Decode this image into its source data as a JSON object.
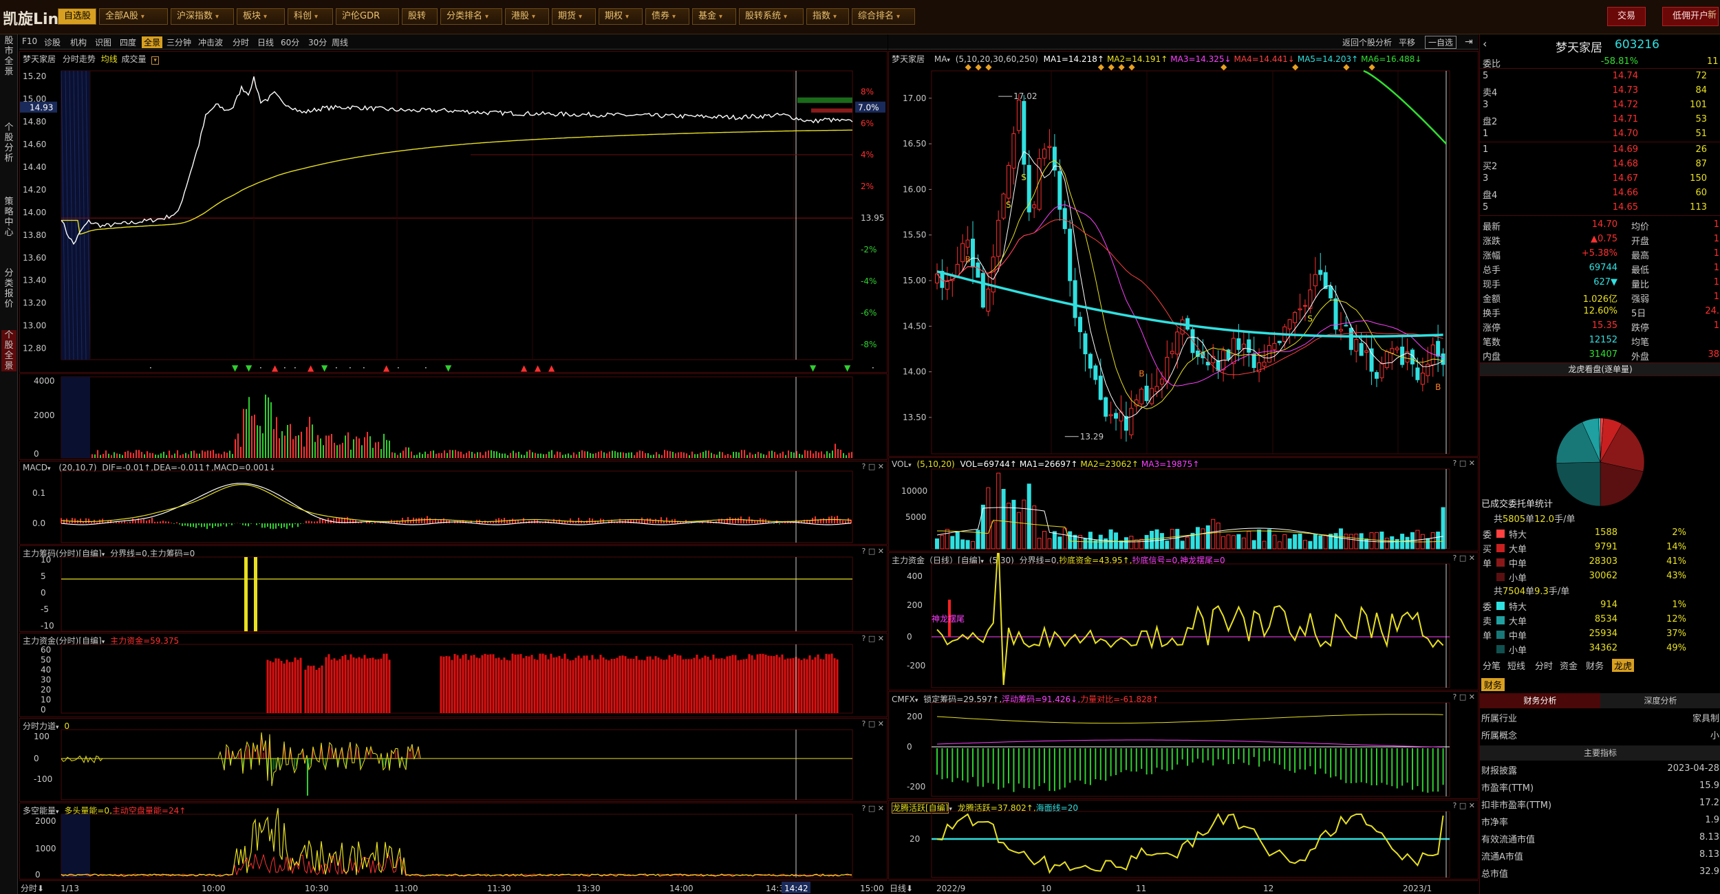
{
  "topbar": {
    "logo": "凯旋Lin",
    "menu": [
      {
        "label": "自选股",
        "active": true
      },
      {
        "label": "全部A股",
        "dd": true
      },
      {
        "label": "沪深指数",
        "dd": true
      },
      {
        "label": "板块",
        "dd": true
      },
      {
        "label": "科创",
        "dd": true
      },
      {
        "label": "沪伦GDR"
      },
      {
        "label": "股转"
      },
      {
        "label": "分类排名",
        "dd": true
      },
      {
        "label": "港股",
        "dd": true
      },
      {
        "label": "期货",
        "dd": true
      },
      {
        "label": "期权",
        "dd": true
      },
      {
        "label": "债券",
        "dd": true
      },
      {
        "label": "基金",
        "dd": true
      },
      {
        "label": "股转系统",
        "dd": true
      },
      {
        "label": "指数",
        "dd": true
      },
      {
        "label": "综合排名",
        "dd": true
      }
    ],
    "right_buttons": [
      "交易",
      "低佣开户",
      "新"
    ]
  },
  "toolbar_left": [
    "F10",
    "诊股",
    "机构",
    "识图",
    "四度",
    "全景",
    "三分钟",
    "冲击波",
    "分时",
    "日线",
    "60分",
    "30分",
    "周线"
  ],
  "toolbar_right": [
    "返回个股分析",
    "平移",
    "一自选"
  ],
  "side_tabs": [
    "股市全景",
    "个股分析",
    "策略中心",
    "分类报价",
    "个股全景"
  ],
  "intraday": {
    "title": "梦天家居",
    "subtitle": "分时走势",
    "legend_avg": "均线",
    "legend_vol": "成交量",
    "price_ticks": [
      "15.20",
      "15.00",
      "14.80",
      "14.60",
      "14.40",
      "14.20",
      "14.00",
      "13.80",
      "13.60",
      "13.40",
      "13.20",
      "13.00",
      "12.80"
    ],
    "pct_ticks": [
      "8%",
      "6%",
      "4%",
      "2%",
      "-2%",
      "-4%",
      "-6%",
      "-8%"
    ],
    "cur_price": "14.93",
    "cur_pct": "7.0%",
    "prev_close": "13.95",
    "vol_ticks": [
      "4000",
      "2000",
      "0"
    ],
    "macd_label": "MACD",
    "macd_params": "(20,10,7)",
    "macd_vals": "DIF=-0.01↑,DEA=-0.011↑,MACD=0.001↓",
    "macd_ticks": [
      "0.1",
      "0.0"
    ],
    "zlcm_label": "主力筹码(分时)[自编]",
    "zlcm_vals": "分界线=0,主力筹码=0",
    "zlcm_ticks": [
      "10",
      "5",
      "0",
      "-5",
      "-10"
    ],
    "zlzj_label": "主力资金(分时)[自编]",
    "zlzj_vals": "主力资金=59.375",
    "zlzj_ticks": [
      "60",
      "50",
      "40",
      "30",
      "20",
      "10",
      "0"
    ],
    "fsld_label": "分时力道",
    "fsld_vals": "0",
    "fsld_ticks": [
      "100",
      "0",
      "-100"
    ],
    "dkn_label": "多空能量",
    "dkn_vals1": "多头量能=0,",
    "dkn_vals2": "主动空盘量能=24↑",
    "dkn_ticks": [
      "2000",
      "1000",
      "0"
    ],
    "time_labels": [
      "1/13",
      "10:00",
      "10:30",
      "11:00",
      "11:30",
      "13:30",
      "14:00",
      "14:30",
      "15:00"
    ],
    "time_box": "14:42",
    "bottom_left": "分时"
  },
  "daily": {
    "title": "梦天家居",
    "ma_label": "MA",
    "ma_params": "(5,10,20,30,60,250)",
    "ma_vals": [
      {
        "t": "MA1=14.218↑",
        "c": "#ffffff"
      },
      {
        "t": "MA2=14.191↑",
        "c": "#e8e020"
      },
      {
        "t": "MA3=14.325↓",
        "c": "#ff40ff"
      },
      {
        "t": "MA4=14.441↓",
        "c": "#ff4040"
      },
      {
        "t": "MA5=14.203↑",
        "c": "#30e0e0"
      },
      {
        "t": "MA6=16.488↓",
        "c": "#30e030"
      }
    ],
    "price_ticks": [
      "17.00",
      "16.50",
      "16.00",
      "15.50",
      "15.00",
      "14.50",
      "14.00",
      "13.50"
    ],
    "high_label": "17.02",
    "low_label": "13.29",
    "vol_label": "VOL",
    "vol_params": "(5,10,20)",
    "vol_vals": [
      {
        "t": "VOL=69744↑",
        "c": "#ffffff"
      },
      {
        "t": "MA1=26697↑",
        "c": "#ffffff"
      },
      {
        "t": "MA2=23062↑",
        "c": "#e8e020"
      },
      {
        "t": "MA3=19875↑",
        "c": "#ff40ff"
      }
    ],
    "vol_ticks": [
      "10000",
      "5000"
    ],
    "zlzj_label": "主力资金（日线）[自编]",
    "zlzj_params": "(5,30)",
    "zlzj_vals1": "分界线=0,",
    "zlzj_vals2": "抄底资金=43.95↑,",
    "zlzj_vals3": "抄底信号=0,神龙摆尾=0",
    "zlzj_ticks": [
      "400",
      "200",
      "0",
      "-200"
    ],
    "zlzj_marker": "神龙摆尾",
    "cmfx_label": "CMFX",
    "cmfx_vals1": "锁定筹码=29.597↑,",
    "cmfx_vals2": "浮动筹码=91.426↓,",
    "cmfx_vals3": "力量对比=-61.828↑",
    "cmfx_ticks": [
      "200",
      "0",
      "-200"
    ],
    "lthy_label": "龙腾活跃[自编]",
    "lthy_vals1": "龙腾活跃=37.802↑,",
    "lthy_vals2": "海面线=20",
    "lthy_ticks": [
      "20"
    ],
    "date_labels": [
      "2022/9",
      "10",
      "11",
      "12",
      "2023/1"
    ],
    "bottom_left": "日线"
  },
  "quote": {
    "name": "梦天家居",
    "code": "603216",
    "webi_label": "委比",
    "webi_val": "-58.81%",
    "webi_num": "11",
    "sell": [
      {
        "l": "5",
        "p": "14.74",
        "v": "72"
      },
      {
        "l": "卖4",
        "p": "14.73",
        "v": "84"
      },
      {
        "l": "3",
        "p": "14.72",
        "v": "101"
      },
      {
        "l": "盘2",
        "p": "14.71",
        "v": "53"
      },
      {
        "l": "1",
        "p": "14.70",
        "v": "51"
      }
    ],
    "buy": [
      {
        "l": "1",
        "p": "14.69",
        "v": "26"
      },
      {
        "l": "买2",
        "p": "14.68",
        "v": "87"
      },
      {
        "l": "3",
        "p": "14.67",
        "v": "150"
      },
      {
        "l": "盘4",
        "p": "14.66",
        "v": "60"
      },
      {
        "l": "5",
        "p": "14.65",
        "v": "113"
      }
    ],
    "stats": [
      {
        "a": "最新",
        "av": "14.70",
        "ac": "#ff3030",
        "b": "均价",
        "bv": "1"
      },
      {
        "a": "涨跌",
        "av": "▲0.75",
        "ac": "#ff3030",
        "b": "开盘",
        "bv": "1"
      },
      {
        "a": "涨幅",
        "av": "+5.38%",
        "ac": "#ff3030",
        "b": "最高",
        "bv": "1"
      },
      {
        "a": "总手",
        "av": "69744",
        "ac": "#30e0e0",
        "b": "最低",
        "bv": "1"
      },
      {
        "a": "现手",
        "av": "627▼",
        "ac": "#30e0e0",
        "b": "量比",
        "bv": "1"
      },
      {
        "a": "金额",
        "av": "1.026亿",
        "ac": "#e8e020",
        "b": "强弱",
        "bv": "1"
      },
      {
        "a": "换手",
        "av": "12.60%",
        "ac": "#e8e020",
        "b": "5日",
        "bv": "24."
      },
      {
        "a": "涨停",
        "av": "15.35",
        "ac": "#ff3030",
        "b": "跌停",
        "bv": "1"
      },
      {
        "a": "笔数",
        "av": "12152",
        "ac": "#30e0e0",
        "b": "均笔",
        "bv": ""
      },
      {
        "a": "内盘",
        "av": "31407",
        "ac": "#30e030",
        "b": "外盘",
        "bv": "38"
      }
    ],
    "pie_title": "龙虎看盘(逐单量)",
    "order_stats_title": "已成交委托单统计",
    "buy_group_title_pre": "共",
    "buy_group_count": "5805",
    "buy_group_title_mid": "单",
    "buy_group_avg": "12.0",
    "buy_group_title_post": "手/单",
    "buy_rows": [
      {
        "side": "委",
        "t": "特大",
        "v": "1588",
        "p": "2%",
        "c": "#ff4040"
      },
      {
        "side": "买",
        "t": "大单",
        "v": "9791",
        "p": "14%",
        "c": "#c82020"
      },
      {
        "side": "单",
        "t": "中单",
        "v": "28303",
        "p": "41%",
        "c": "#8a1818"
      },
      {
        "side": "",
        "t": "小单",
        "v": "30062",
        "p": "43%",
        "c": "#5a1010"
      }
    ],
    "sell_group_title_pre": "共",
    "sell_group_count": "7504",
    "sell_group_title_mid": "单",
    "sell_group_avg": "9.3",
    "sell_group_title_post": "手/单",
    "sell_rows": [
      {
        "side": "委",
        "t": "特大",
        "v": "914",
        "p": "1%",
        "c": "#30e0e0"
      },
      {
        "side": "卖",
        "t": "大单",
        "v": "8534",
        "p": "12%",
        "c": "#20a0a0"
      },
      {
        "side": "单",
        "t": "中单",
        "v": "25934",
        "p": "37%",
        "c": "#187878"
      },
      {
        "side": "",
        "t": "小单",
        "v": "34362",
        "p": "49%",
        "c": "#105050"
      }
    ],
    "tabs": [
      "分笔",
      "短线",
      "分时",
      "资金",
      "财务",
      "龙虎"
    ],
    "fin_tab": "财务",
    "fin_sub1": "财务分析",
    "fin_sub2": "深度分析",
    "industry_label": "所属行业",
    "industry_val": "家具制",
    "concept_label": "所属概念",
    "concept_val": "小",
    "main_idx": "主要指标",
    "fin_rows": [
      {
        "a": "财报披露",
        "b": "2023-04-28"
      },
      {
        "a": "市盈率(TTM)",
        "b": "15.9"
      },
      {
        "a": "扣非市盈率(TTM)",
        "b": "17.2"
      },
      {
        "a": "市净率",
        "b": "1.9"
      },
      {
        "a": "有效流通市值",
        "b": "8.13"
      },
      {
        "a": "流通A市值",
        "b": "8.13"
      },
      {
        "a": "总市值",
        "b": "32.9"
      }
    ]
  }
}
